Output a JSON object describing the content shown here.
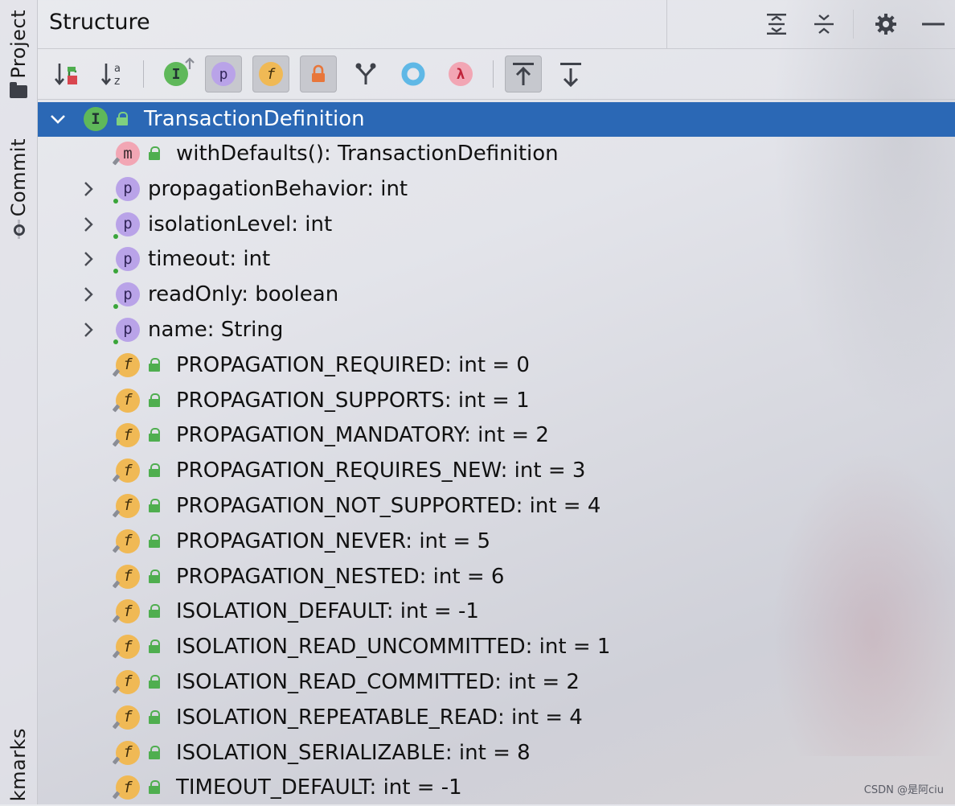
{
  "side_tabs": {
    "project": "Project",
    "commit": "Commit",
    "bookmarks": "kmarks"
  },
  "header": {
    "title": "Structure",
    "buttons": [
      "expand-all-icon",
      "collapse-all-icon",
      "gear-icon",
      "hide-icon"
    ]
  },
  "toolbar": {
    "sort_visibility": "sort-by-visibility-icon",
    "sort_alpha_top": "a",
    "sort_alpha_bottom": "z",
    "inherited_label": "I",
    "properties_label": "p",
    "fields_label": "f",
    "lambda_label": "λ"
  },
  "tree": {
    "root": {
      "label": "TransactionDefinition",
      "icon": "I"
    },
    "items": [
      {
        "type": "method",
        "badge": "m",
        "label": "withDefaults(): TransactionDefinition",
        "expandable": false
      },
      {
        "type": "prop",
        "badge": "p",
        "label": "propagationBehavior: int",
        "expandable": true
      },
      {
        "type": "prop",
        "badge": "p",
        "label": "isolationLevel: int",
        "expandable": true
      },
      {
        "type": "prop",
        "badge": "p",
        "label": "timeout: int",
        "expandable": true
      },
      {
        "type": "prop",
        "badge": "p",
        "label": "readOnly: boolean",
        "expandable": true
      },
      {
        "type": "prop",
        "badge": "p",
        "label": "name: String",
        "expandable": true
      },
      {
        "type": "field",
        "badge": "f",
        "label": "PROPAGATION_REQUIRED: int = 0",
        "expandable": false
      },
      {
        "type": "field",
        "badge": "f",
        "label": "PROPAGATION_SUPPORTS: int = 1",
        "expandable": false
      },
      {
        "type": "field",
        "badge": "f",
        "label": "PROPAGATION_MANDATORY: int = 2",
        "expandable": false
      },
      {
        "type": "field",
        "badge": "f",
        "label": "PROPAGATION_REQUIRES_NEW: int = 3",
        "expandable": false
      },
      {
        "type": "field",
        "badge": "f",
        "label": "PROPAGATION_NOT_SUPPORTED: int = 4",
        "expandable": false
      },
      {
        "type": "field",
        "badge": "f",
        "label": "PROPAGATION_NEVER: int = 5",
        "expandable": false
      },
      {
        "type": "field",
        "badge": "f",
        "label": "PROPAGATION_NESTED: int = 6",
        "expandable": false
      },
      {
        "type": "field",
        "badge": "f",
        "label": "ISOLATION_DEFAULT: int = -1",
        "expandable": false
      },
      {
        "type": "field",
        "badge": "f",
        "label": "ISOLATION_READ_UNCOMMITTED: int = 1",
        "expandable": false
      },
      {
        "type": "field",
        "badge": "f",
        "label": "ISOLATION_READ_COMMITTED: int = 2",
        "expandable": false
      },
      {
        "type": "field",
        "badge": "f",
        "label": "ISOLATION_REPEATABLE_READ: int = 4",
        "expandable": false
      },
      {
        "type": "field",
        "badge": "f",
        "label": "ISOLATION_SERIALIZABLE: int = 8",
        "expandable": false
      },
      {
        "type": "field",
        "badge": "f",
        "label": "TIMEOUT_DEFAULT: int = -1",
        "expandable": false
      }
    ]
  },
  "watermark": "CSDN @是阿ciu",
  "colors": {
    "selection": "#2b68b5",
    "interface": "#5fb85a",
    "method": "#f2a6b4",
    "property": "#b9a3e8",
    "field": "#f0b955",
    "lock": "#4fae4f"
  }
}
